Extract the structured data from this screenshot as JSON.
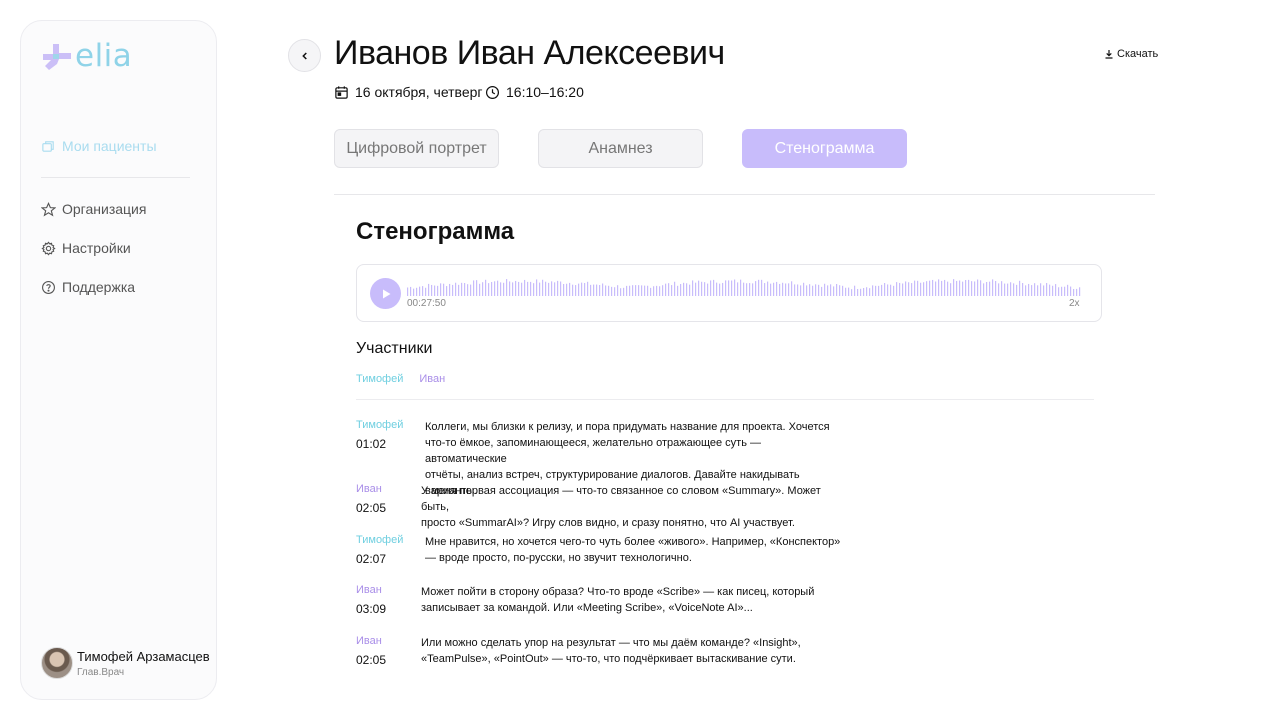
{
  "sidebar": {
    "logo_text": "elia",
    "items": [
      {
        "label": "Мои пациенты",
        "icon": "folders-icon",
        "active": true
      },
      {
        "label": "Организация",
        "icon": "star-icon",
        "active": false
      },
      {
        "label": "Настройки",
        "icon": "gear-icon",
        "active": false
      },
      {
        "label": "Поддержка",
        "icon": "help-circle-icon",
        "active": false
      }
    ],
    "user": {
      "name": "Тимофей Арзамасцев",
      "role": "Глав.Врач"
    }
  },
  "header": {
    "title": "Иванов Иван Алексеевич",
    "date": "16 октября, четверг",
    "time": "16:10–16:20",
    "download_label": "Скачать"
  },
  "tabs": [
    {
      "label": "Цифровой портрет",
      "active": false
    },
    {
      "label": "Анамнез",
      "active": false
    },
    {
      "label": "Стенограмма",
      "active": true
    }
  ],
  "section_title": "Стенограмма",
  "player": {
    "time": "00:27:50",
    "speed": "2x"
  },
  "participants": {
    "title": "Участники",
    "names": [
      "Тимофей",
      "Иван"
    ]
  },
  "transcript": [
    {
      "speaker": "Тимофей",
      "time": "01:02",
      "lines": [
        "Коллеги, мы близки к релизу, и пора придумать название для проекта. Хочется",
        "что-то ёмкое, запоминающееся, желательно отражающее суть — автоматические",
        "отчёты, анализ встреч, структурирование диалогов. Давайте накидывать варианты."
      ]
    },
    {
      "speaker": "Иван",
      "time": "02:05",
      "lines": [
        "У меня первая ассоциация — что-то связанное со словом «Summary». Может быть,",
        "просто «SummarAI»? Игру слов видно, и сразу понятно, что AI участвует."
      ]
    },
    {
      "speaker": "Тимофей",
      "time": "02:07",
      "lines": [
        "Мне нравится, но хочется чего-то чуть более «живого». Например, «Конспектор»",
        "— вроде просто, по-русски, но звучит технологично."
      ]
    },
    {
      "speaker": "Иван",
      "time": "03:09",
      "lines": [
        "Может пойти в сторону образа? Что-то вроде «Scribe» — как писец, который",
        "записывает за командой. Или «Meeting Scribe», «VoiceNote AI»..."
      ]
    },
    {
      "speaker": "Иван",
      "time": "02:05",
      "lines": [
        "Или можно сделать упор на результат — что мы даём команде? «Insight»,",
        "«TeamPulse», «PointOut» — что-то, что подчёркивает вытаскивание сути."
      ]
    }
  ],
  "colors": {
    "accent": "#c8bcfb",
    "speaker_timofey": "#6fcfe0",
    "speaker_ivan": "#a98ee8",
    "logo": "#8fd3e8"
  }
}
